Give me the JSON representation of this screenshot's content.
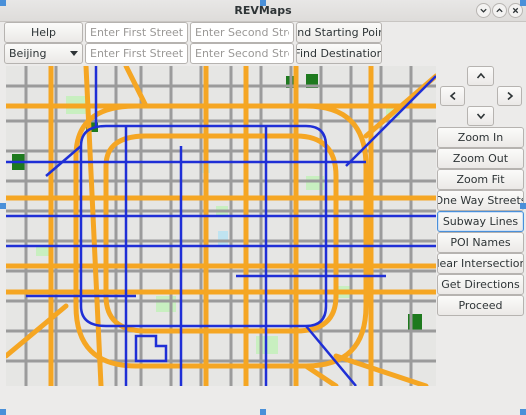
{
  "window": {
    "title": "REVMaps"
  },
  "toolbar": {
    "help_label": "Help",
    "map_select": "Beijing",
    "start_first_street_placeholder": "Enter First Street",
    "start_second_street_placeholder": "Enter Second Street",
    "find_start_label": "Find Starting Point",
    "dest_first_street_placeholder": "Enter First Street",
    "dest_second_street_placeholder": "Enter Second Street",
    "find_dest_label": "Find Destination"
  },
  "controls": {
    "zoom_in": "Zoom In",
    "zoom_out": "Zoom Out",
    "zoom_fit": "Zoom Fit",
    "one_way": "One Way Streets",
    "subway": "Subway Lines",
    "poi_names": "POI Names",
    "clear": "Clear Intersections",
    "directions": "Get Directions",
    "proceed": "Proceed"
  },
  "map_colors": {
    "background": "#e6e6e4",
    "street": "#9b9b9b",
    "highway": "#f5a623",
    "subway": "#1f2fd6",
    "park": "#c8efc0",
    "forest": "#1e7a1e",
    "water": "#bfe3f0"
  }
}
